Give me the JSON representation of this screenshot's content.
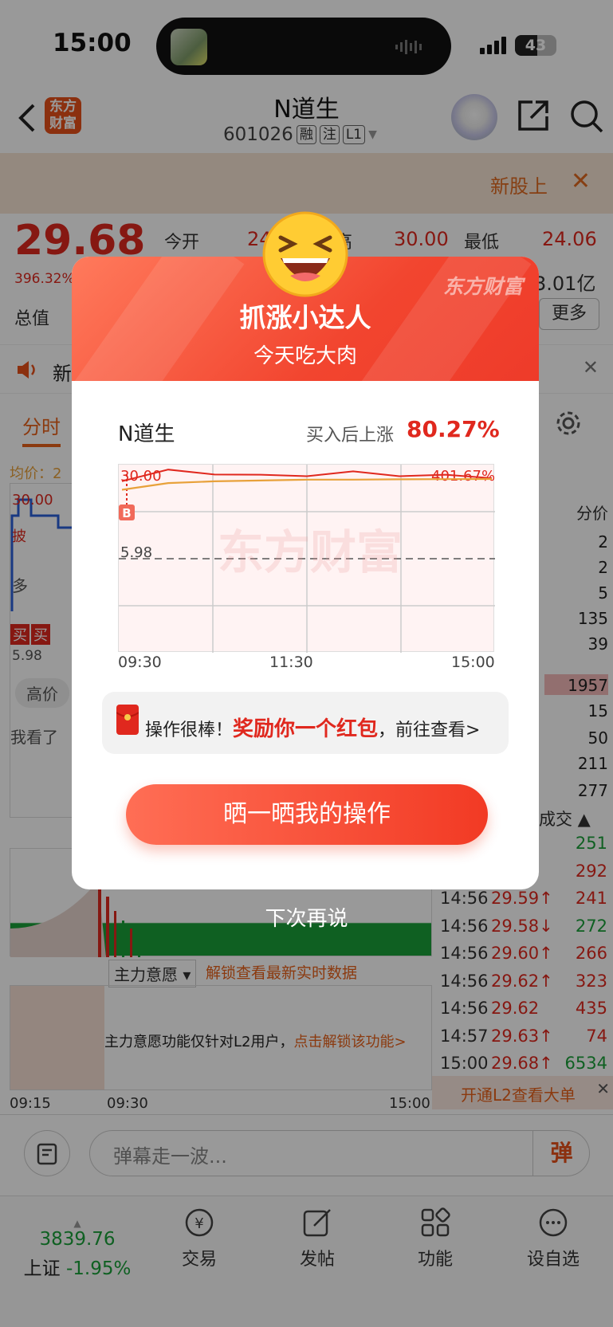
{
  "status_bar": {
    "time": "15:00",
    "battery": "43"
  },
  "header": {
    "logo_text": "东方财富",
    "stock_name": "N道生",
    "stock_code": "601026",
    "tags": [
      "融",
      "注",
      "L1"
    ]
  },
  "banner": {
    "text": "新股上"
  },
  "quote": {
    "price": "29.68",
    "change_pct": "396.32%",
    "open_label": "今开",
    "open_value": "24",
    "high_label": "高",
    "high_value": "30.00",
    "low_label": "最低",
    "low_value": "24.06",
    "total_label": "总值",
    "volume_partial": "3.01亿",
    "more_label": "更多"
  },
  "notice": {
    "text": "新"
  },
  "tabs": {
    "active": "分时"
  },
  "chart_bg": {
    "avg_label": "均价：2",
    "high_mark": "30.00",
    "low_mark": "5.98",
    "tags": [
      "买",
      "买"
    ],
    "side_label_1": "披",
    "side_label_2": "多",
    "pill_1": "高价",
    "pill_2": "我看了",
    "main_label": "主力意愿",
    "unlock_text": "解锁查看最新实时数据",
    "l2_notice": "主力意愿功能仅针对L2用户，",
    "l2_link": "点击解锁该功能>",
    "x_start": "09:15",
    "x_mid": "09:30",
    "x_end": "15:00"
  },
  "order_book": {
    "header": "分价",
    "rows": [
      "2",
      "2",
      "5",
      "135",
      "39",
      "1957",
      "15",
      "50",
      "211",
      "277"
    ],
    "tick_header": "成交"
  },
  "ticks": [
    {
      "time": "",
      "price": "",
      "vol": "251",
      "color": "#19a13a"
    },
    {
      "time": "",
      "price": "↑",
      "vol": "292",
      "color": "#e0281e"
    },
    {
      "time": "14:56",
      "price": "29.59↑",
      "vol": "241",
      "color": "#e0281e"
    },
    {
      "time": "14:56",
      "price": "29.58↓",
      "vol": "272",
      "color": "#19a13a"
    },
    {
      "time": "14:56",
      "price": "29.60↑",
      "vol": "266",
      "color": "#e0281e"
    },
    {
      "time": "14:56",
      "price": "29.62↑",
      "vol": "323",
      "color": "#e0281e"
    },
    {
      "time": "14:56",
      "price": "29.62",
      "vol": "435",
      "color": "#e0281e"
    },
    {
      "time": "14:57",
      "price": "29.63↑",
      "vol": "74",
      "color": "#e0281e"
    },
    {
      "time": "15:00",
      "price": "29.68↑",
      "vol": "6534",
      "color": "#19a13a"
    }
  ],
  "l2_bigorder": "开通L2查看大单",
  "danmu": {
    "placeholder": "弹幕走一波...",
    "button": "弹"
  },
  "tabbar": {
    "index_value": "3839.76",
    "index_name": "上证",
    "index_change": "-1.95%",
    "items": [
      "交易",
      "发帖",
      "功能",
      "设自选"
    ]
  },
  "modal": {
    "brand": "东方财富",
    "title": "抓涨小达人",
    "subtitle": "今天吃大肉",
    "stock": "N道生",
    "up_label": "买入后上涨",
    "up_value": "80.27%",
    "chart_high": "30.00",
    "chart_pct": "401.67%",
    "chart_low": "5.98",
    "buy_marker": "B",
    "watermark": "东方财富",
    "x_labels": [
      "09:30",
      "11:30",
      "15:00"
    ],
    "reward_prefix": "操作很棒！",
    "reward_strong": "奖励你一个红包",
    "reward_suffix": "，前往查看>",
    "share_button": "晒一晒我的操作",
    "later": "下次再说"
  },
  "chart_data": {
    "type": "line",
    "x": [
      "09:30",
      "11:30",
      "15:00"
    ],
    "series": [
      {
        "values": [
          29.5,
          30.0,
          29.9,
          29.7,
          29.8,
          29.9,
          29.8,
          29.7,
          29.68
        ]
      },
      {
        "values": [
          28.9,
          29.3,
          29.4,
          29.45,
          29.5,
          29.5,
          29.52,
          29.53,
          29.54
        ]
      }
    ],
    "reference_line": 5.98,
    "colors": [
      "#e0281e",
      "#e8a13a"
    ]
  }
}
